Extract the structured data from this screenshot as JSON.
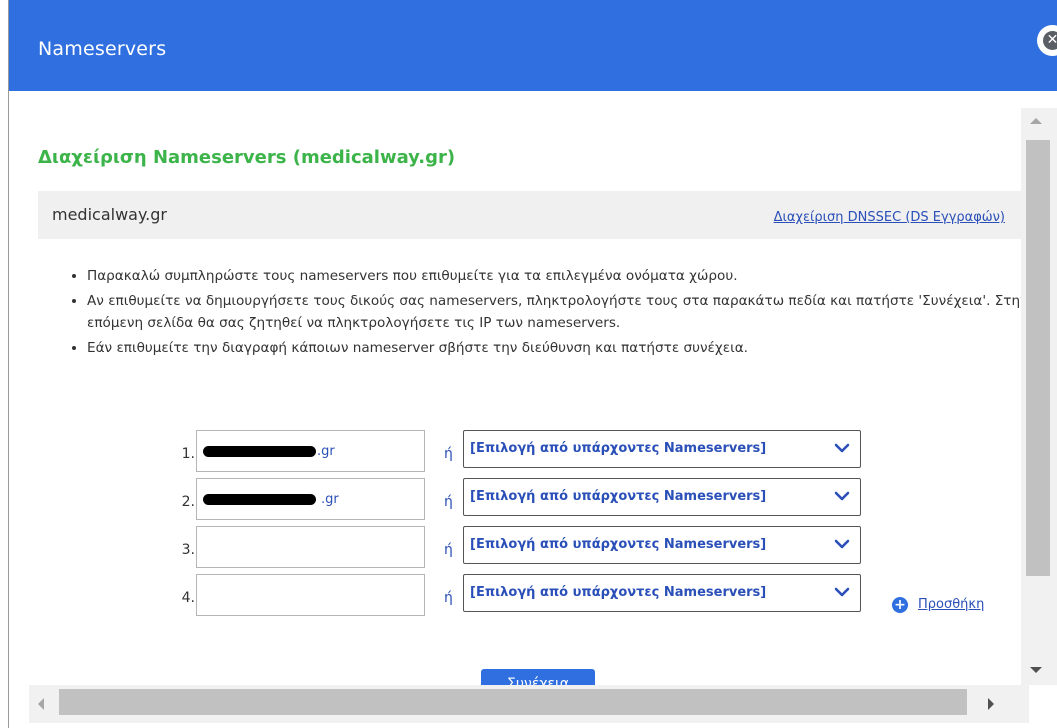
{
  "dialog": {
    "title": "Nameservers",
    "close_icon": "close-circle-icon"
  },
  "section": {
    "title": "Διαχείριση Nameservers (medicalway.gr)"
  },
  "domain_bar": {
    "domain": "medicalway.gr",
    "dnssec_link": "Διαχείριση DNSSEC (DS Εγγραφών)"
  },
  "instructions": [
    "Παρακαλώ συμπληρώστε τους nameservers που επιθυμείτε για τα επιλεγμένα ονόματα χώρου.",
    "Αν επιθυμείτε να δημιουργήσετε τους δικούς σας nameservers, πληκτρολογήστε τους στα παρακάτω πεδία και πατήστε 'Συνέχεια'. Στην επόμενη σελίδα θα σας ζητηθεί να πληκτρολογήσετε τις IP των nameservers.",
    "Εάν επιθυμείτε την διαγραφή κάποιων nameserver σβήστε την διεύθυνση και πατήστε συνέχεια."
  ],
  "nameservers": [
    {
      "num": "1.",
      "value_suffix": ".gr",
      "redacted": true,
      "or": "ή",
      "select": "[Επιλογή από υπάρχοντες Nameservers]"
    },
    {
      "num": "2.",
      "value_suffix": ".gr",
      "redacted": true,
      "or": "ή",
      "select": "[Επιλογή από υπάρχοντες Nameservers]"
    },
    {
      "num": "3.",
      "value_suffix": "",
      "redacted": false,
      "or": "ή",
      "select": "[Επιλογή από υπάρχοντες Nameservers]"
    },
    {
      "num": "4.",
      "value_suffix": "",
      "redacted": false,
      "or": "ή",
      "select": "[Επιλογή από υπάρχοντες Nameservers]"
    }
  ],
  "add": {
    "label": "Προσθήκη",
    "icon": "plus-circle-icon"
  },
  "continue_button": {
    "label": "Συνέχεια"
  },
  "colors": {
    "header": "#2f6fe0",
    "title_green": "#3cb44a",
    "link_blue": "#2a4fb8"
  }
}
